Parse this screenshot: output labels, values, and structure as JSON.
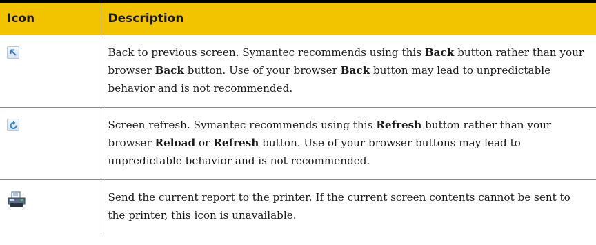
{
  "table": {
    "headers": {
      "icon": "Icon",
      "description": "Description"
    },
    "rows": [
      {
        "icon": "back-arrow-icon",
        "segments": [
          {
            "t": "Back to previous screen. Symantec recommends using this ",
            "b": false
          },
          {
            "t": "Back",
            "b": true
          },
          {
            "t": " button rather than your browser ",
            "b": false
          },
          {
            "t": "Back",
            "b": true
          },
          {
            "t": " button. Use of your browser ",
            "b": false
          },
          {
            "t": "Back",
            "b": true
          },
          {
            "t": " button may lead to unpredictable behavior and is not recommended.",
            "b": false
          }
        ]
      },
      {
        "icon": "refresh-icon",
        "segments": [
          {
            "t": "Screen refresh. Symantec recommends using this ",
            "b": false
          },
          {
            "t": "Refresh",
            "b": true
          },
          {
            "t": " button rather than your browser ",
            "b": false
          },
          {
            "t": "Reload",
            "b": true
          },
          {
            "t": " or ",
            "b": false
          },
          {
            "t": "Refresh",
            "b": true
          },
          {
            "t": " button. Use of your browser buttons may lead to unpredictable behavior and is not recommended.",
            "b": false
          }
        ]
      },
      {
        "icon": "printer-icon",
        "segments": [
          {
            "t": "Send the current report to the printer. If the current screen contents cannot be sent to the printer, this icon is unavailable.",
            "b": false
          }
        ]
      }
    ]
  },
  "colors": {
    "header_bg": "#f2c400",
    "top_rule": "#000000",
    "grid_line": "#8a8a8a"
  }
}
